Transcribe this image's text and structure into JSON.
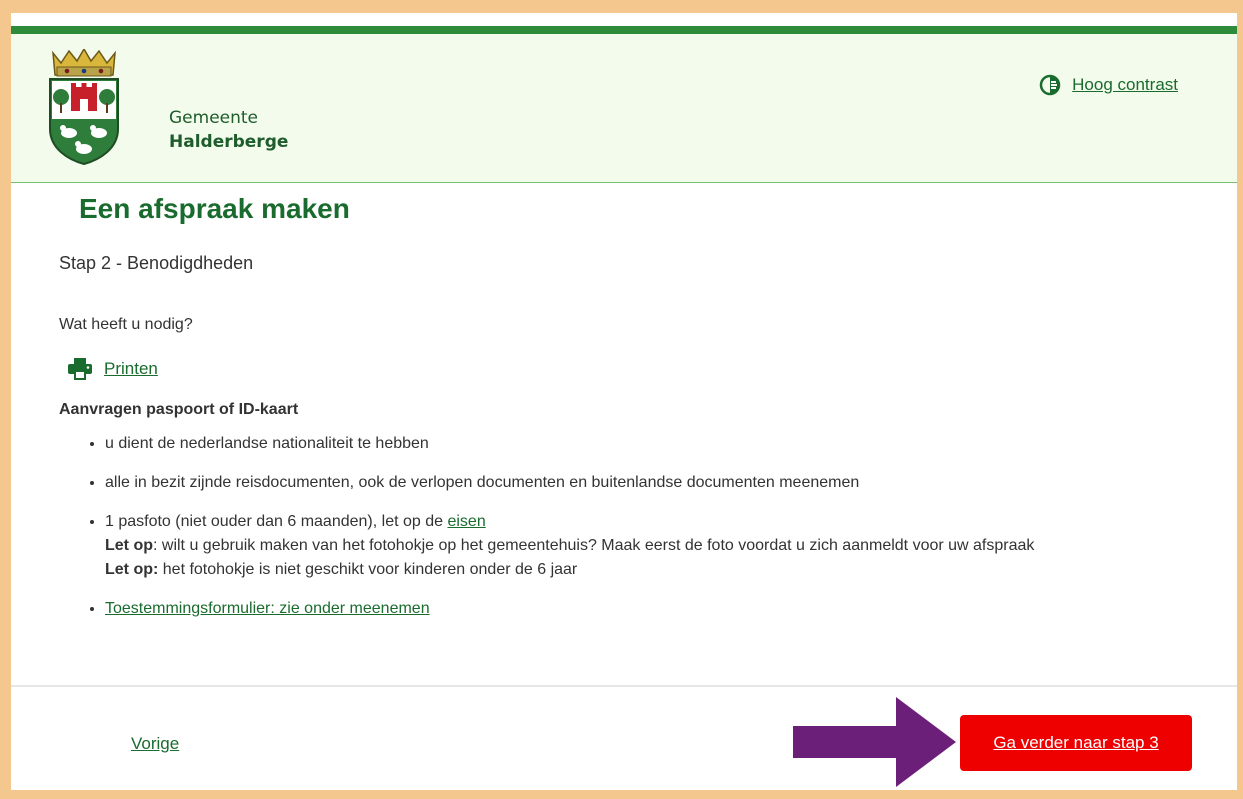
{
  "header": {
    "brand_line1": "Gemeente",
    "brand_line2": "Halderberge",
    "contrast_label": "Hoog contrast"
  },
  "main": {
    "title": "Een afspraak maken",
    "step": "Stap 2 - Benodigdheden",
    "question": "Wat heeft u nodig?",
    "print_label": "Printen",
    "section_title": "Aanvragen paspoort of ID-kaart",
    "items": [
      {
        "text": "u dient de nederlandse nationaliteit te hebben"
      },
      {
        "text": "alle in bezit zijnde reisdocumenten, ook de verlopen documenten en buitenlandse documenten meenemen"
      },
      {
        "text": "1 pasfoto (niet ouder dan 6 maanden), let op de ",
        "link": "eisen",
        "note1_label": "Let op",
        "note1_text": ": wilt u gebruik maken van het fotohokje op het gemeentehuis? Maak eerst de foto voordat u zich aanmeldt voor uw afspraak",
        "note2_label": "Let op:",
        "note2_text": " het fotohokje is niet geschikt voor kinderen onder de 6 jaar"
      },
      {
        "link": "Toestemmingsformulier: zie onder meenemen"
      }
    ]
  },
  "footer": {
    "prev_label": "Vorige",
    "next_label": "Ga verder naar stap 3"
  },
  "icons": {
    "logo": "municipal-coat-of-arms",
    "contrast": "contrast-icon",
    "print": "printer-icon",
    "annotation": "purple-arrow"
  },
  "colors": {
    "background": "#f4c78f",
    "brand_green": "#1a6b2e",
    "top_bar": "#2e8b3a",
    "header_bg": "#f3fbec",
    "next_button": "#ee0000",
    "arrow": "#6b1f78"
  }
}
